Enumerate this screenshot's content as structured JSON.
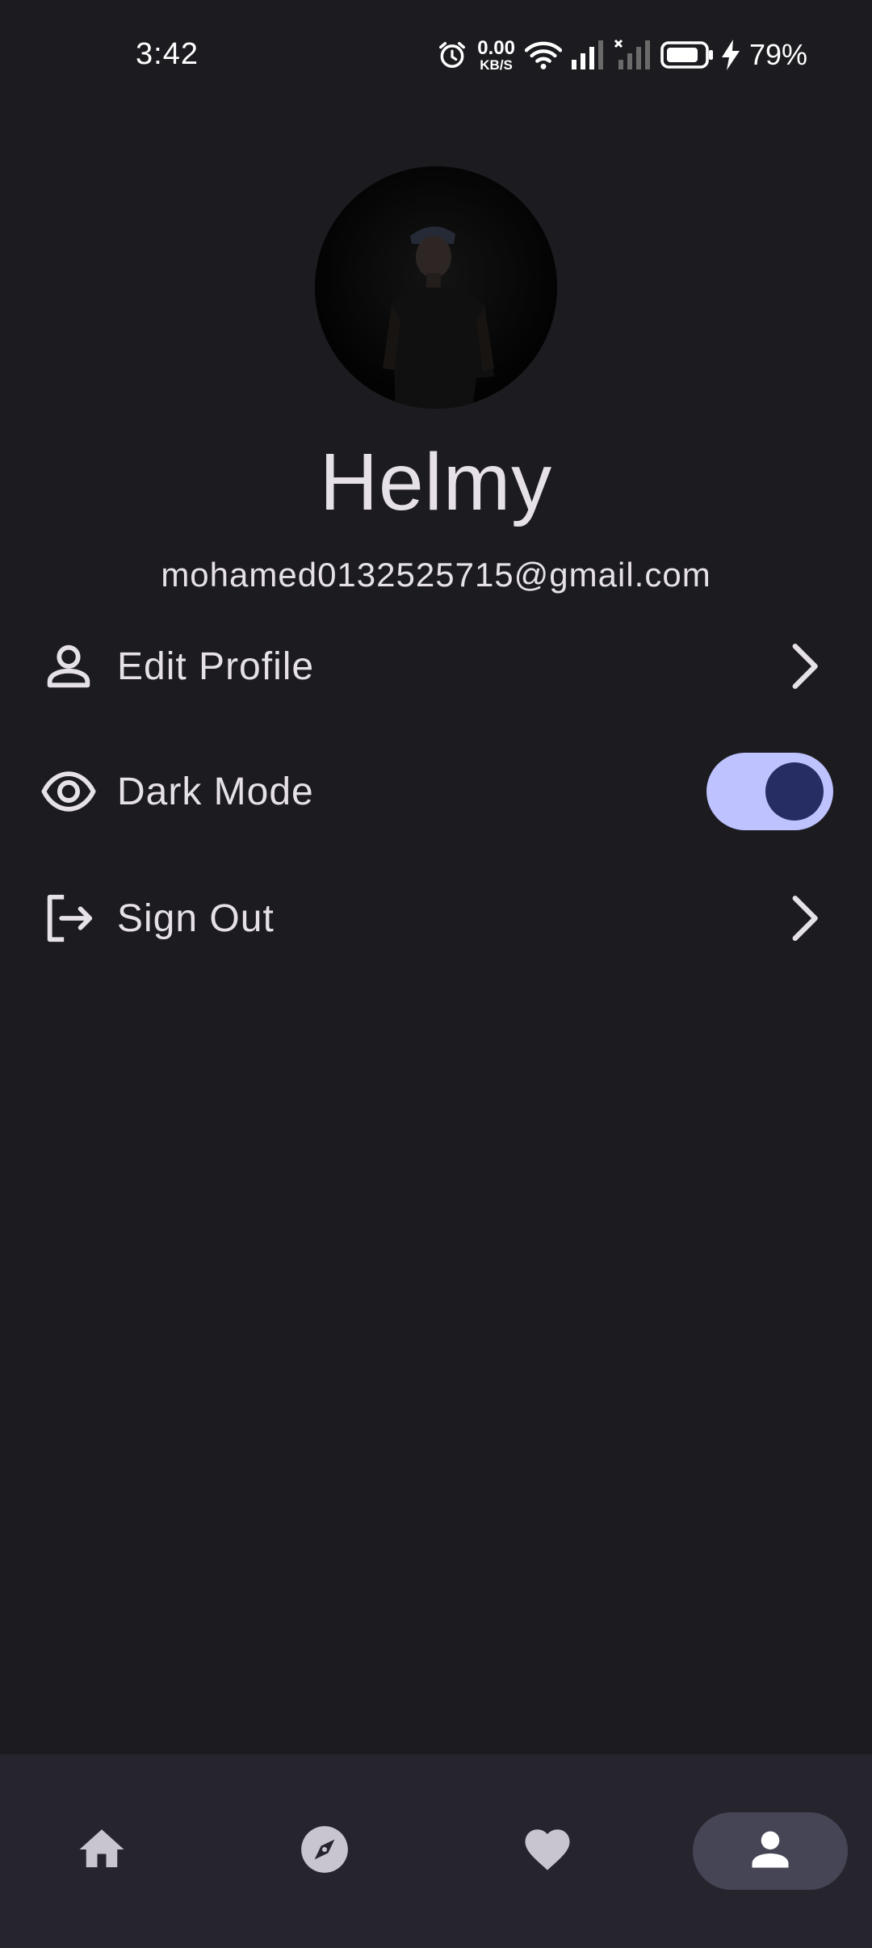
{
  "status_bar": {
    "time": "3:42",
    "net_speed_value": "0.00",
    "net_speed_unit": "KB/S",
    "battery_percent": "79%",
    "icons": [
      "alarm-icon",
      "wifi-icon",
      "signal-icon",
      "signal-no-service-icon",
      "battery-icon",
      "charging-icon"
    ]
  },
  "profile": {
    "name": "Helmy",
    "email": "mohamed0132525715@gmail.com"
  },
  "settings": {
    "items": [
      {
        "label": "Edit Profile",
        "icon": "person-icon",
        "trailing": "chevron-right-icon"
      },
      {
        "label": "Dark Mode",
        "icon": "eye-icon",
        "trailing": "toggle"
      },
      {
        "label": "Sign Out",
        "icon": "logout-icon",
        "trailing": "chevron-right-icon"
      }
    ],
    "dark_mode_enabled": true
  },
  "bottom_nav": {
    "items": [
      {
        "icon": "home-icon",
        "active": false
      },
      {
        "icon": "compass-icon",
        "active": false
      },
      {
        "icon": "heart-icon",
        "active": false
      },
      {
        "icon": "person-icon",
        "active": true
      }
    ]
  },
  "colors": {
    "background": "#1c1b20",
    "text": "#e6e1e8",
    "toggle_track": "#bec2ff",
    "toggle_knob": "#252d63",
    "nav_background": "#26252e",
    "nav_active_indicator": "#464556",
    "nav_icon": "#c8c5d0"
  }
}
